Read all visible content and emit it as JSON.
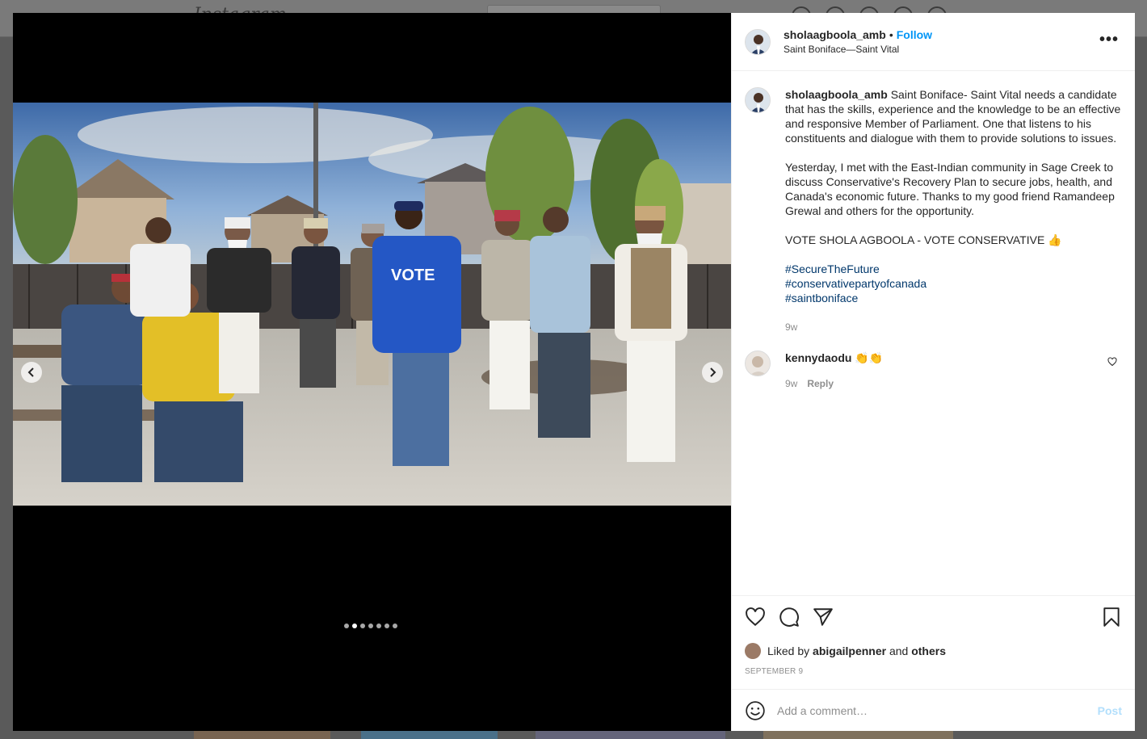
{
  "background": {
    "logo_text": "Instagram"
  },
  "post": {
    "username": "sholaagboola_amb",
    "separator": "•",
    "follow_label": "Follow",
    "location": "Saint Boniface—Saint Vital",
    "more_label": "•••",
    "carousel": {
      "total": 7,
      "active_index": 1
    },
    "photo_vote_text": "VOTE",
    "caption": {
      "username": "sholaagboola_amb",
      "paragraph1": "Saint Boniface- Saint Vital needs a candidate that has the skills, experience and the knowledge to be an effective and responsive Member of Parliament. One that listens to his constituents and dialogue with them to provide solutions to issues.",
      "paragraph2": "Yesterday, I met with the East-Indian community in Sage Creek to discuss Conservative's Recovery Plan to secure jobs, health, and Canada's economic future. Thanks to my good friend Ramandeep Grewal and others for the opportunity.",
      "paragraph3": "VOTE SHOLA AGBOOLA - VOTE CONSERVATIVE 👍",
      "hashtags": [
        "#SecureTheFuture",
        "#conservativepartyofcanada",
        "#saintboniface"
      ],
      "age": "9w"
    },
    "comments": [
      {
        "username": "kennydaodu",
        "text": "👏👏",
        "age": "9w",
        "reply_label": "Reply"
      }
    ],
    "liked": {
      "prefix": "Liked by",
      "user": "abigailpenner",
      "and": "and",
      "others": "others"
    },
    "date": "SEPTEMBER 9",
    "add_comment": {
      "placeholder": "Add a comment…",
      "post_label": "Post"
    }
  },
  "colors": {
    "accent": "#0095f6",
    "hashtag": "#00376b",
    "muted": "#8e8e8e",
    "post_disabled": "#b2dffc"
  },
  "icons": [
    "heart-icon",
    "comment-icon",
    "share-icon",
    "bookmark-icon",
    "emoji-icon",
    "chevron-left-icon",
    "chevron-right-icon",
    "more-icon"
  ]
}
